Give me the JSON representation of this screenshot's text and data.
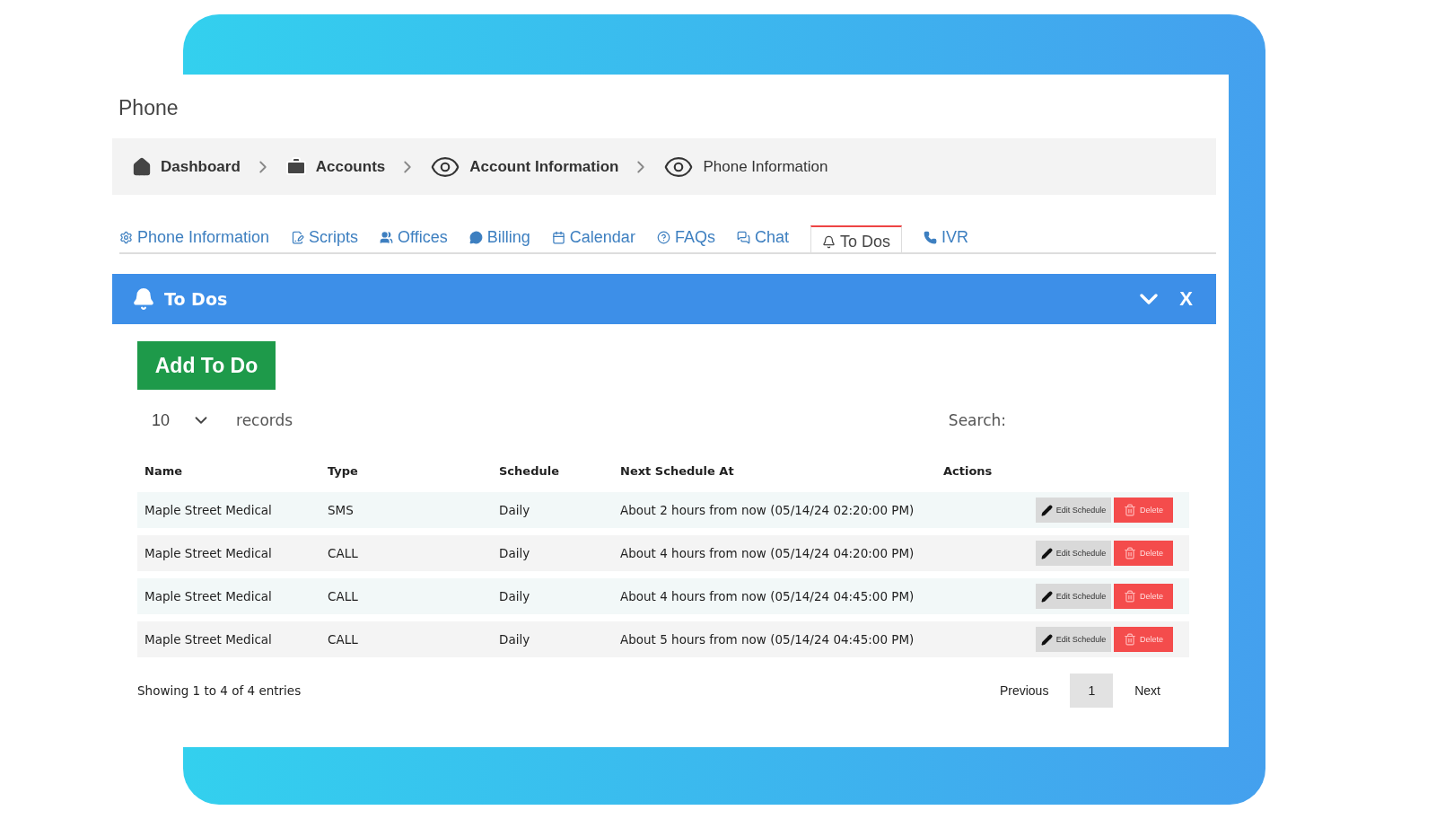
{
  "page_title": "Phone",
  "breadcrumbs": [
    {
      "label": "Dashboard"
    },
    {
      "label": "Accounts"
    },
    {
      "label": "Account Information"
    },
    {
      "label": "Phone Information"
    }
  ],
  "tabs": [
    {
      "label": "Phone Information",
      "selected": false
    },
    {
      "label": "Scripts",
      "selected": false
    },
    {
      "label": "Offices",
      "selected": false
    },
    {
      "label": "Billing",
      "selected": false
    },
    {
      "label": "Calendar",
      "selected": false
    },
    {
      "label": "FAQs",
      "selected": false
    },
    {
      "label": "Chat",
      "selected": false
    },
    {
      "label": "To Dos",
      "selected": true
    },
    {
      "label": "IVR",
      "selected": false
    }
  ],
  "panel": {
    "title": "To Dos",
    "close_label": "X"
  },
  "add_button": "Add To Do",
  "page_size": {
    "value": "10",
    "label": "records"
  },
  "search": {
    "label": "Search:"
  },
  "table": {
    "columns": [
      "Name",
      "Type",
      "Schedule",
      "Next Schedule At",
      "Actions"
    ],
    "rows": [
      {
        "name": "Maple Street Medical",
        "type": "SMS",
        "schedule": "Daily",
        "next": "About 2 hours from now (05/14/24 02:20:00 PM)",
        "actions": [
          "Edit Schedule",
          "Delete"
        ]
      },
      {
        "name": "Maple Street Medical",
        "type": "CALL",
        "schedule": "Daily",
        "next": "About 4 hours from now (05/14/24 04:20:00 PM)",
        "actions": [
          "Edit Schedule",
          "Delete"
        ]
      },
      {
        "name": "Maple Street Medical",
        "type": "CALL",
        "schedule": "Daily",
        "next": "About 4 hours from now (05/14/24 04:45:00 PM)",
        "actions": [
          "Edit Schedule",
          "Delete"
        ]
      },
      {
        "name": "Maple Street Medical",
        "type": "CALL",
        "schedule": "Daily",
        "next": "About 5 hours from now (05/14/24 04:45:00 PM)",
        "actions": [
          "Edit Schedule",
          "Delete"
        ]
      }
    ]
  },
  "footer": {
    "info": "Showing 1 to 4 of 4 entries",
    "pagination": [
      {
        "label": "Previous",
        "selected": false
      },
      {
        "label": "1",
        "selected": true
      },
      {
        "label": "Next",
        "selected": false
      }
    ]
  }
}
